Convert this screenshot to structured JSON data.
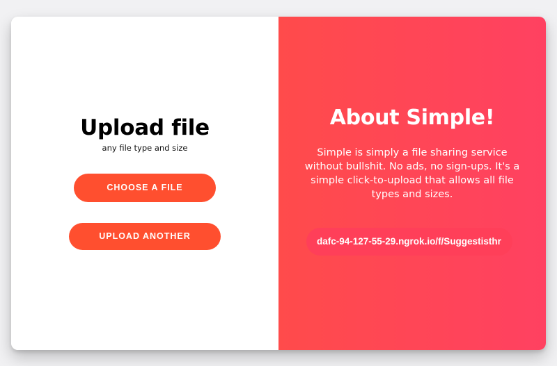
{
  "upload_panel": {
    "title": "Upload file",
    "subtitle": "any file type and size",
    "choose_button": "CHOOSE A FILE",
    "upload_another_button": "UPLOAD ANOTHER"
  },
  "about_panel": {
    "title": "About Simple!",
    "description": "Simple is simply a file sharing service without bullshit. No ads, no sign-ups. It's a simple click-to-upload that allows all file types and sizes.",
    "share_link": "dafc-94-127-55-29.ngrok.io/f/Suggestisthr"
  },
  "colors": {
    "button": "#ff4f2f",
    "gradient_start": "#ff4b4b",
    "gradient_end": "#ff4161",
    "page_background": "#f1f1f3"
  }
}
